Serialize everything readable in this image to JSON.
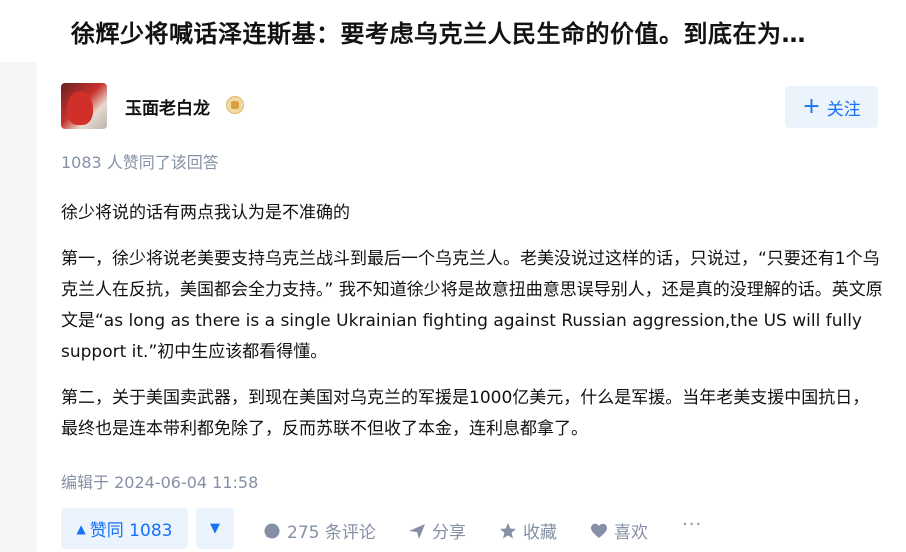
{
  "header": {
    "title": "徐辉少将喊话泽连斯基：要考虑乌克兰人民生命的价值。到底在为…"
  },
  "answer": {
    "author": "玉面老白龙",
    "follow_label": "关注",
    "agree_text": "1083 人赞同了该回答",
    "paragraphs": [
      "徐少将说的话有两点我认为是不准确的",
      "第一，徐少将说老美要支持乌克兰战斗到最后一个乌克兰人。老美没说过这样的话，只说过，“只要还有1个乌克兰人在反抗，美国都会全力支持。” 我不知道徐少将是故意扭曲意思误导别人，还是真的没理解的话。英文原文是“as long as there is a single Ukrainian fighting against Russian aggression,the US will fully support it.”初中生应该都看得懂。",
      "第二，关于美国卖武器，到现在美国对乌克兰的军援是1000亿美元，什么是军援。当年老美支援中国抗日，最终也是连本带利都免除了，反而苏联不但收了本金，连利息都拿了。"
    ],
    "edited": "编辑于 2024-06-04 11:58"
  },
  "actions": {
    "vote_label": "赞同 1083",
    "comments": "275 条评论",
    "share": "分享",
    "favorite": "收藏",
    "like": "喜欢",
    "more": "···"
  },
  "colors": {
    "accent": "#1772f6",
    "accent_bg": "#ebf3fd",
    "muted": "#8590a6",
    "text": "#121212"
  }
}
